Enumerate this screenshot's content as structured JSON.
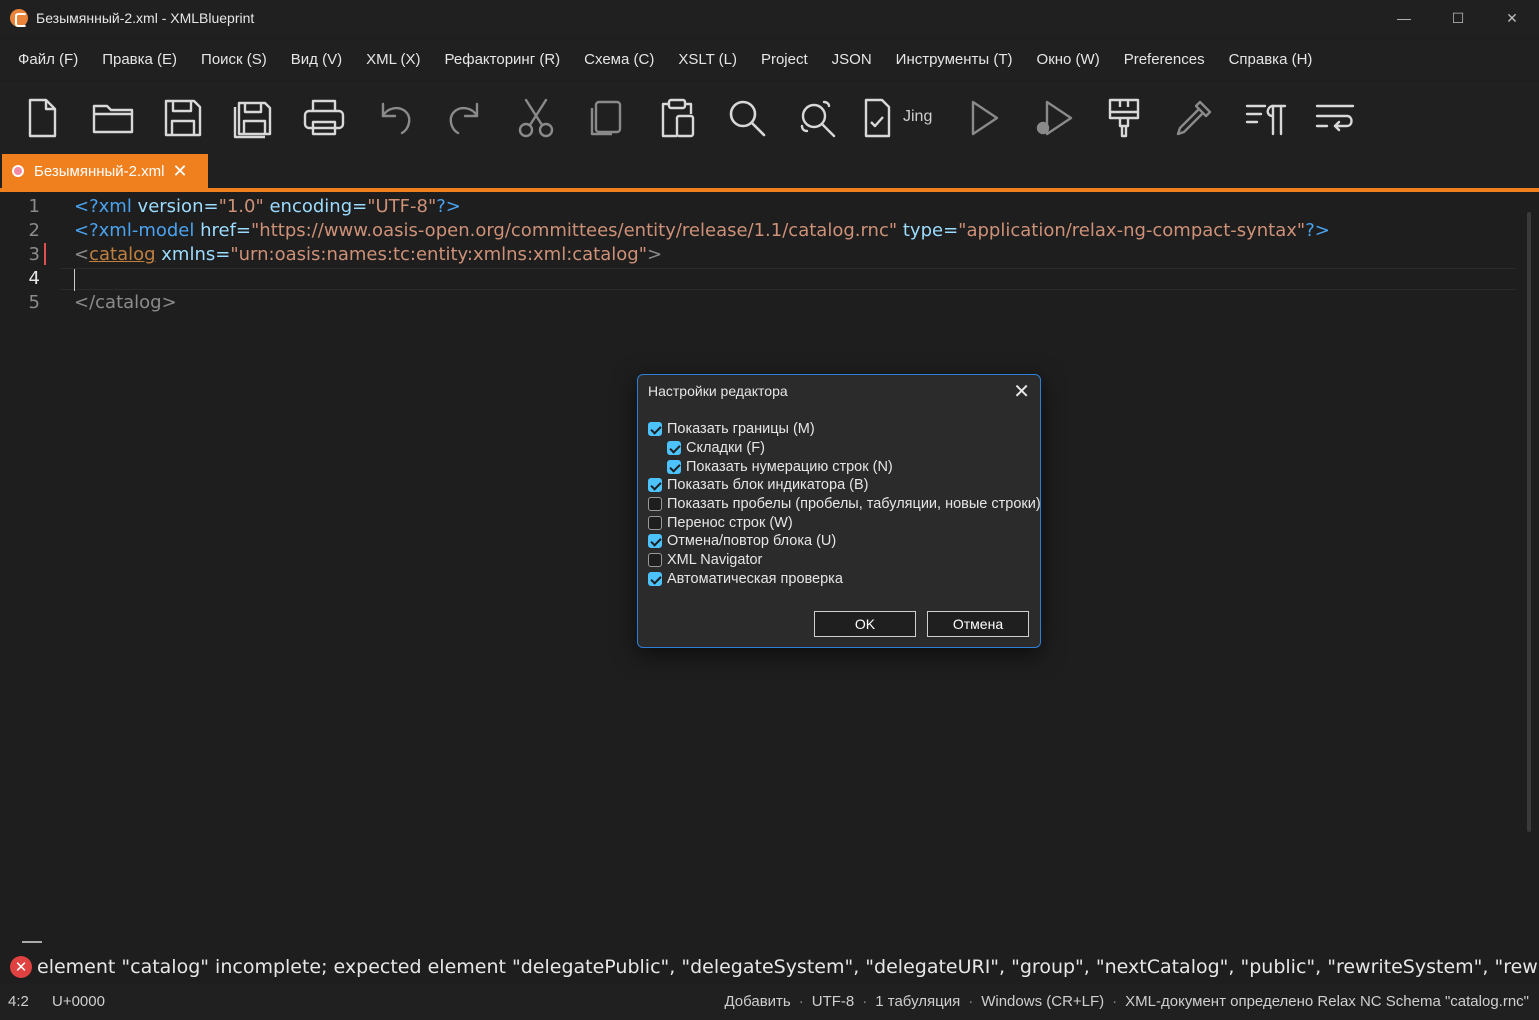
{
  "window": {
    "title": "Безымянный-2.xml - XMLBlueprint",
    "minimize": "—",
    "maximize": "☐",
    "close": "✕"
  },
  "menu": [
    "Файл (F)",
    "Правка (E)",
    "Поиск (S)",
    "Вид (V)",
    "XML (X)",
    "Рефакторинг (R)",
    "Схема (C)",
    "XSLT (L)",
    "Project",
    "JSON",
    "Инструменты (T)",
    "Окно (W)",
    "Preferences",
    "Справка (H)"
  ],
  "toolbar": {
    "jing_label": "Jing",
    "buttons": [
      "new-file",
      "open-folder",
      "save",
      "save-all",
      "print",
      "undo",
      "redo",
      "cut",
      "copy",
      "paste",
      "find",
      "find-replace",
      "validate-jing",
      "run",
      "run-debug",
      "format-brush",
      "pipette",
      "pilcrow-indent",
      "wrap-lines"
    ]
  },
  "tab": {
    "label": "Безымянный-2.xml",
    "close": "✕"
  },
  "editor": {
    "line_numbers": [
      "1",
      "2",
      "3",
      "4",
      "5"
    ],
    "line1": {
      "open": "<?xml",
      "attr1": " version=",
      "val1": "\"1.0\"",
      "attr2": " encoding=",
      "val2": "\"UTF-8\"",
      "close": "?>"
    },
    "line2": {
      "open": "<?xml-model",
      "attr1": " href=",
      "val1": "\"https://www.oasis-open.org/committees/entity/release/1.1/catalog.rnc\"",
      "attr2": " type=",
      "val2": "\"application/relax-ng-compact-syntax\"",
      "close": "?>"
    },
    "line3": {
      "lt": "<",
      "tag": "catalog",
      "attr1": " xmlns=",
      "val1": "\"urn:oasis:names:tc:entity:xmlns:xml:catalog\"",
      "gt": ">"
    },
    "line5": "</catalog>"
  },
  "dialog": {
    "title": "Настройки редактора",
    "close": "✕",
    "options": [
      {
        "label": "Показать границы (M)",
        "checked": true,
        "indent": false
      },
      {
        "label": "Складки (F)",
        "checked": true,
        "indent": true
      },
      {
        "label": "Показать нумерацию строк (N)",
        "checked": true,
        "indent": true
      },
      {
        "label": "Показать блок индикатора (B)",
        "checked": true,
        "indent": false
      },
      {
        "label": "Показать пробелы (пробелы, табуляции, новые строки)",
        "checked": false,
        "indent": false
      },
      {
        "label": "Перенос строк (W)",
        "checked": false,
        "indent": false
      },
      {
        "label": "Отмена/повтор блока (U)",
        "checked": true,
        "indent": false
      },
      {
        "label": "XML Navigator",
        "checked": false,
        "indent": false
      },
      {
        "label": "Автоматическая проверка",
        "checked": true,
        "indent": false
      }
    ],
    "ok": "OK",
    "cancel": "Отмена"
  },
  "error": {
    "icon": "✕",
    "message": "element \"catalog\" incomplete; expected element \"delegatePublic\", \"delegateSystem\", \"delegateURI\", \"group\", \"nextCatalog\", \"public\", \"rewriteSystem\", \"rewriteURI\""
  },
  "status": {
    "position": "4:2",
    "unicode": "U+0000",
    "mode": "Добавить",
    "encoding": "UTF-8",
    "indent": "1 табуляция",
    "line_endings": "Windows (CR+LF)",
    "schema": "XML-документ определено Relax NC Schema \"catalog.rnc\"",
    "separator": "·"
  },
  "colors": {
    "accent": "#f0801e",
    "dialog_border": "#2f7fd6",
    "checkbox": "#4cc2ff",
    "error": "#e04141"
  }
}
